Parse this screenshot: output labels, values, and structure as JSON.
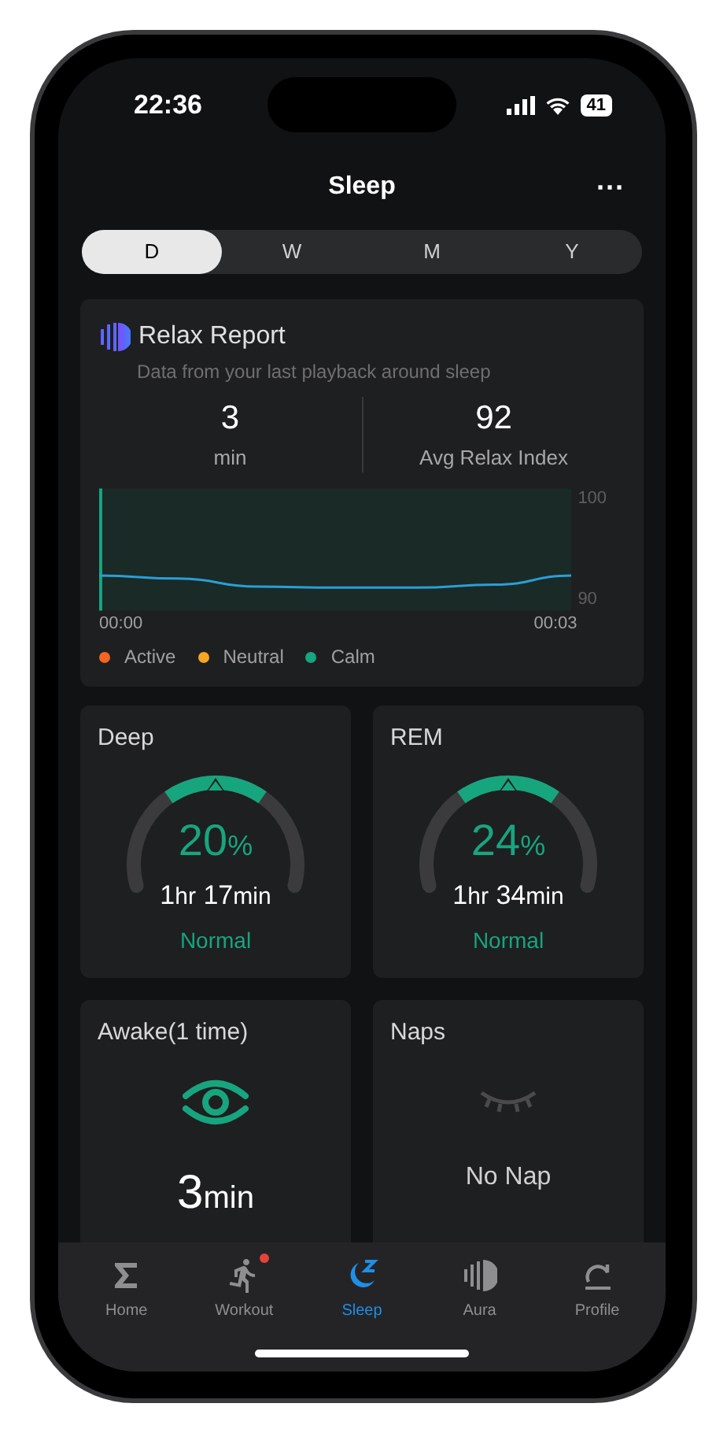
{
  "status_bar": {
    "time": "22:36",
    "battery": "41"
  },
  "header": {
    "title": "Sleep",
    "menu": "···"
  },
  "tabs": [
    {
      "label": "D",
      "selected": true
    },
    {
      "label": "W",
      "selected": false
    },
    {
      "label": "M",
      "selected": false
    },
    {
      "label": "Y",
      "selected": false
    }
  ],
  "relax_report": {
    "title": "Relax Report",
    "subtitle": "Data from your last playback around sleep",
    "stats": [
      {
        "value": "3",
        "label": "min"
      },
      {
        "value": "92",
        "label": "Avg Relax Index"
      }
    ],
    "chart_data": {
      "type": "line",
      "x": [
        -0.15,
        0.4,
        0.95,
        1.5,
        2.05,
        2.6,
        3.13
      ],
      "xlim": [
        -0.15,
        3.13
      ],
      "xticks": [
        {
          "value": 0,
          "label": "00:00"
        },
        {
          "value": 3,
          "label": "00:03"
        }
      ],
      "ylim": [
        88.9,
        101.1
      ],
      "yticks": [
        90,
        100
      ],
      "series": [
        {
          "color": "#2a9fd6",
          "values": [
            92.4,
            92.1,
            91.3,
            91.2,
            91.2,
            91.5,
            92.4
          ]
        }
      ]
    },
    "legend": [
      {
        "label": "Active",
        "color": "#f26522"
      },
      {
        "label": "Neutral",
        "color": "#f5a623"
      },
      {
        "label": "Calm",
        "color": "#17a57e"
      }
    ]
  },
  "stages": [
    {
      "title": "Deep",
      "percent": "20",
      "unit": "%",
      "hours": "1",
      "hours_unit": "hr",
      "minutes": "17",
      "minutes_unit": "min",
      "status": "Normal"
    },
    {
      "title": "REM",
      "percent": "24",
      "unit": "%",
      "hours": "1",
      "hours_unit": "hr",
      "minutes": "34",
      "minutes_unit": "min",
      "status": "Normal"
    }
  ],
  "awake": {
    "title": "Awake(1 time)",
    "value": "3",
    "unit": "min"
  },
  "naps": {
    "title": "Naps",
    "text": "No Nap"
  },
  "nav": [
    {
      "label": "Home",
      "kind": "home",
      "selected": false,
      "badge": false
    },
    {
      "label": "Workout",
      "kind": "workout",
      "selected": false,
      "badge": true
    },
    {
      "label": "Sleep",
      "kind": "sleep",
      "selected": true,
      "badge": false
    },
    {
      "label": "Aura",
      "kind": "aura",
      "selected": false,
      "badge": false
    },
    {
      "label": "Profile",
      "kind": "profile",
      "selected": false,
      "badge": false
    }
  ]
}
